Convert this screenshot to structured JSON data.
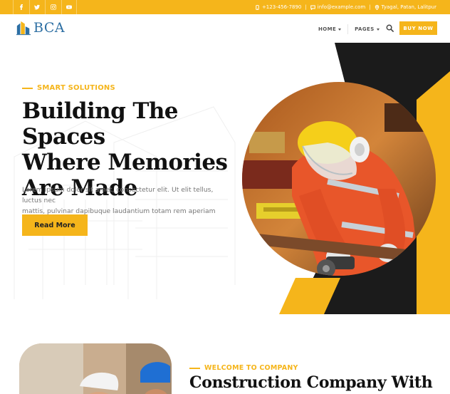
{
  "topbar": {
    "social": [
      {
        "name": "facebook-icon"
      },
      {
        "name": "twitter-icon"
      },
      {
        "name": "instagram-icon"
      },
      {
        "name": "youtube-icon"
      }
    ],
    "phone": "+123-456-7890",
    "email": "info@example.com",
    "address": "Tyagal, Patan, Lalitpur",
    "color": "#f5b51b"
  },
  "header": {
    "logo_text": "BCA",
    "nav": [
      {
        "label": "HOME"
      },
      {
        "label": "PAGES"
      }
    ],
    "buy_label": "BUY NOW"
  },
  "hero": {
    "tagline": "SMART SOLUTIONS",
    "title_lines": [
      "Building The Spaces",
      "Where Memories",
      "Are Made"
    ],
    "description_lines": [
      "Lorem ipsum dolor sit amet, consectetur elit. Ut elit tellus, luctus nec",
      "mattis, pulvinar dapibuque laudantium totam rem aperiam eaque"
    ],
    "button_label": "Read More",
    "accent": "#f5b51b",
    "dark": "#1b1b1b"
  },
  "about": {
    "tagline": "WELCOME TO COMPANY",
    "title": "Construction Company With"
  }
}
